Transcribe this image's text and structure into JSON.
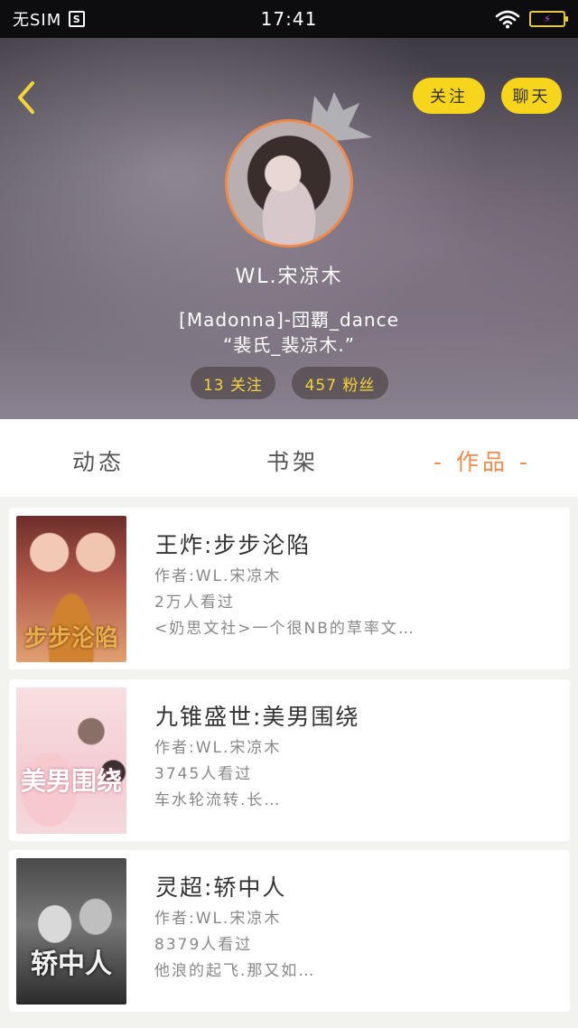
{
  "status_bar": {
    "carrier": "无SIM",
    "sim_badge": "S",
    "time": "17:41",
    "battery_glyph": "⚡"
  },
  "header": {
    "back_icon": "chevron-left-icon",
    "follow_label": "关注",
    "chat_label": "聊天",
    "username": "WL.宋凉木",
    "bio_line1": "[Madonna]-団覇_dance",
    "bio_line2": "“裴氏_裴凉木.”",
    "following": "13 关注",
    "followers": "457 粉丝",
    "accent_color": "#f7d51d",
    "avatar_border_color": "#f08a4b"
  },
  "tabs": [
    {
      "label": "动态"
    },
    {
      "label": "书架"
    },
    {
      "label": "- 作品 -",
      "active": true
    }
  ],
  "works": [
    {
      "cover_text": "步步沦陷",
      "title": "王炸:步步沦陷",
      "author": "作者:WL.宋凉木",
      "views": "2万人看过",
      "desc": "<奶思文社>一个很NB的草率文…"
    },
    {
      "cover_text": "美男围绕",
      "title": "九锥盛世:美男围绕",
      "author": "作者:WL.宋凉木",
      "views": "3745人看过",
      "desc": "车水轮流转.长…"
    },
    {
      "cover_text": "轿中人",
      "title": "灵超:轿中人",
      "author": "作者:WL.宋凉木",
      "views": "8379人看过",
      "desc": "他浪的起飞.那又如…"
    }
  ]
}
